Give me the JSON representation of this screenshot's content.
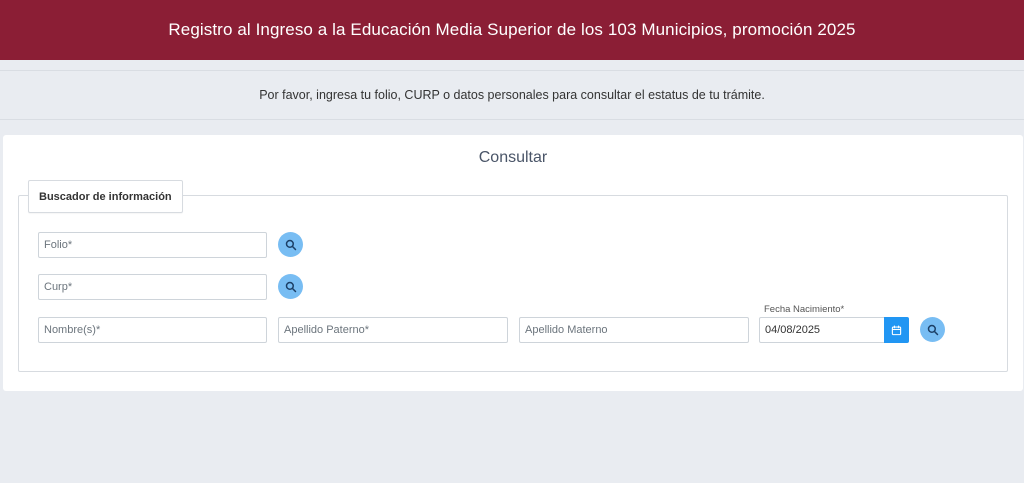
{
  "header": {
    "title": "Registro al Ingreso a la Educación Media Superior de los 103 Municipios, promoción 2025"
  },
  "intro": {
    "text": "Por favor, ingresa tu folio, CURP o datos personales para consultar el estatus de tu trámite."
  },
  "card": {
    "title": "Consultar",
    "legend": "Buscador de información",
    "folio": {
      "placeholder": "Folio*",
      "value": ""
    },
    "curp": {
      "placeholder": "Curp*",
      "value": ""
    },
    "nombre": {
      "placeholder": "Nombre(s)*",
      "value": ""
    },
    "apellido_paterno": {
      "placeholder": "Apellido Paterno*",
      "value": ""
    },
    "apellido_materno": {
      "placeholder": "Apellido Materno",
      "value": ""
    },
    "fecha_nacimiento": {
      "label": "Fecha Nacimiento*",
      "value": "04/08/2025"
    }
  },
  "icons": {
    "search": "search-icon",
    "calendar": "calendar-icon"
  },
  "colors": {
    "header_bg": "#8b1e35",
    "search_button": "#78bdf3",
    "calendar_button": "#2196f3",
    "page_bg": "#e9ecf1"
  }
}
